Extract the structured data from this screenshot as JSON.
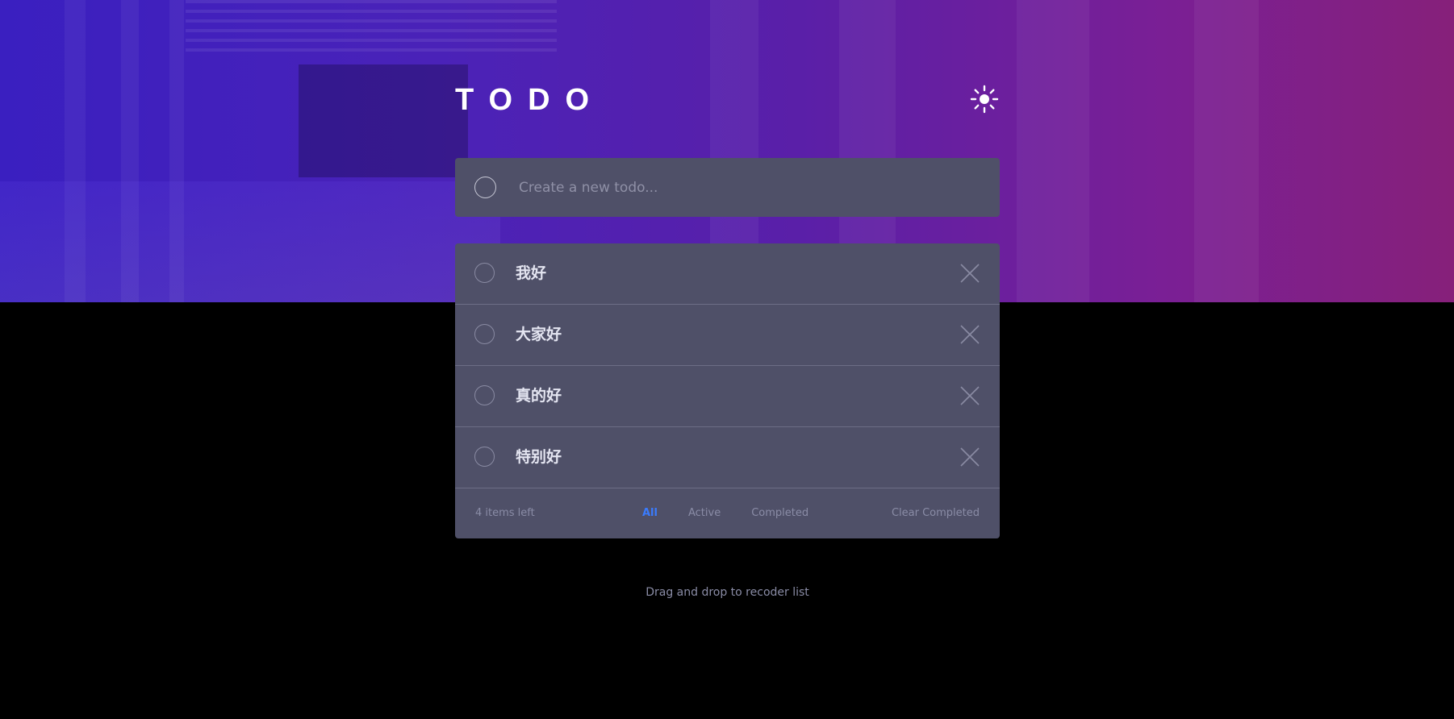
{
  "header": {
    "title": "TODO",
    "theme_icon": "sun-icon"
  },
  "new_todo": {
    "placeholder": "Create a new todo...",
    "value": ""
  },
  "todos": [
    {
      "text": "我好",
      "completed": false
    },
    {
      "text": "大家好",
      "completed": false
    },
    {
      "text": "真的好",
      "completed": false
    },
    {
      "text": "特别好",
      "completed": false
    }
  ],
  "footer": {
    "items_left": "4 items left",
    "filters": [
      "All",
      "Active",
      "Completed"
    ],
    "active_filter": "All",
    "clear_label": "Clear Completed"
  },
  "hint": "Drag and drop to recoder list",
  "colors": {
    "accent": "#3a7bfd",
    "card": "#4f5068",
    "page_bg": "#000000"
  }
}
